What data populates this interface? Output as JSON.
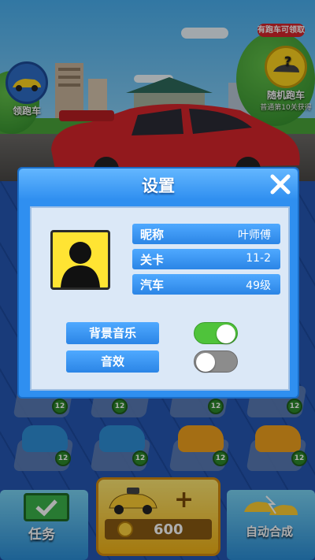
{
  "top": {
    "free_car_label": "领跑车",
    "random_car_badge": "有跑车可领取",
    "random_car_label": "随机跑车",
    "random_car_hint": "普通第10关获得"
  },
  "settings_dialog": {
    "title": "设置",
    "nickname_label": "昵称",
    "nickname_value": "叶师傅",
    "level_label": "关卡",
    "level_value": "11-2",
    "car_label": "汽车",
    "car_value": "49级",
    "music_label": "背景音乐",
    "music_on": true,
    "sfx_label": "音效",
    "sfx_on": false
  },
  "board": {
    "slot_level": "12"
  },
  "bottom": {
    "task_label": "任务",
    "buy_price": "600",
    "merge_label": "自动合成"
  },
  "colors": {
    "dialog_blue": "#2f8ff0",
    "toggle_on": "#4fc33b",
    "toggle_off": "#8c8c8c",
    "coin_gold": "#f2b316"
  }
}
